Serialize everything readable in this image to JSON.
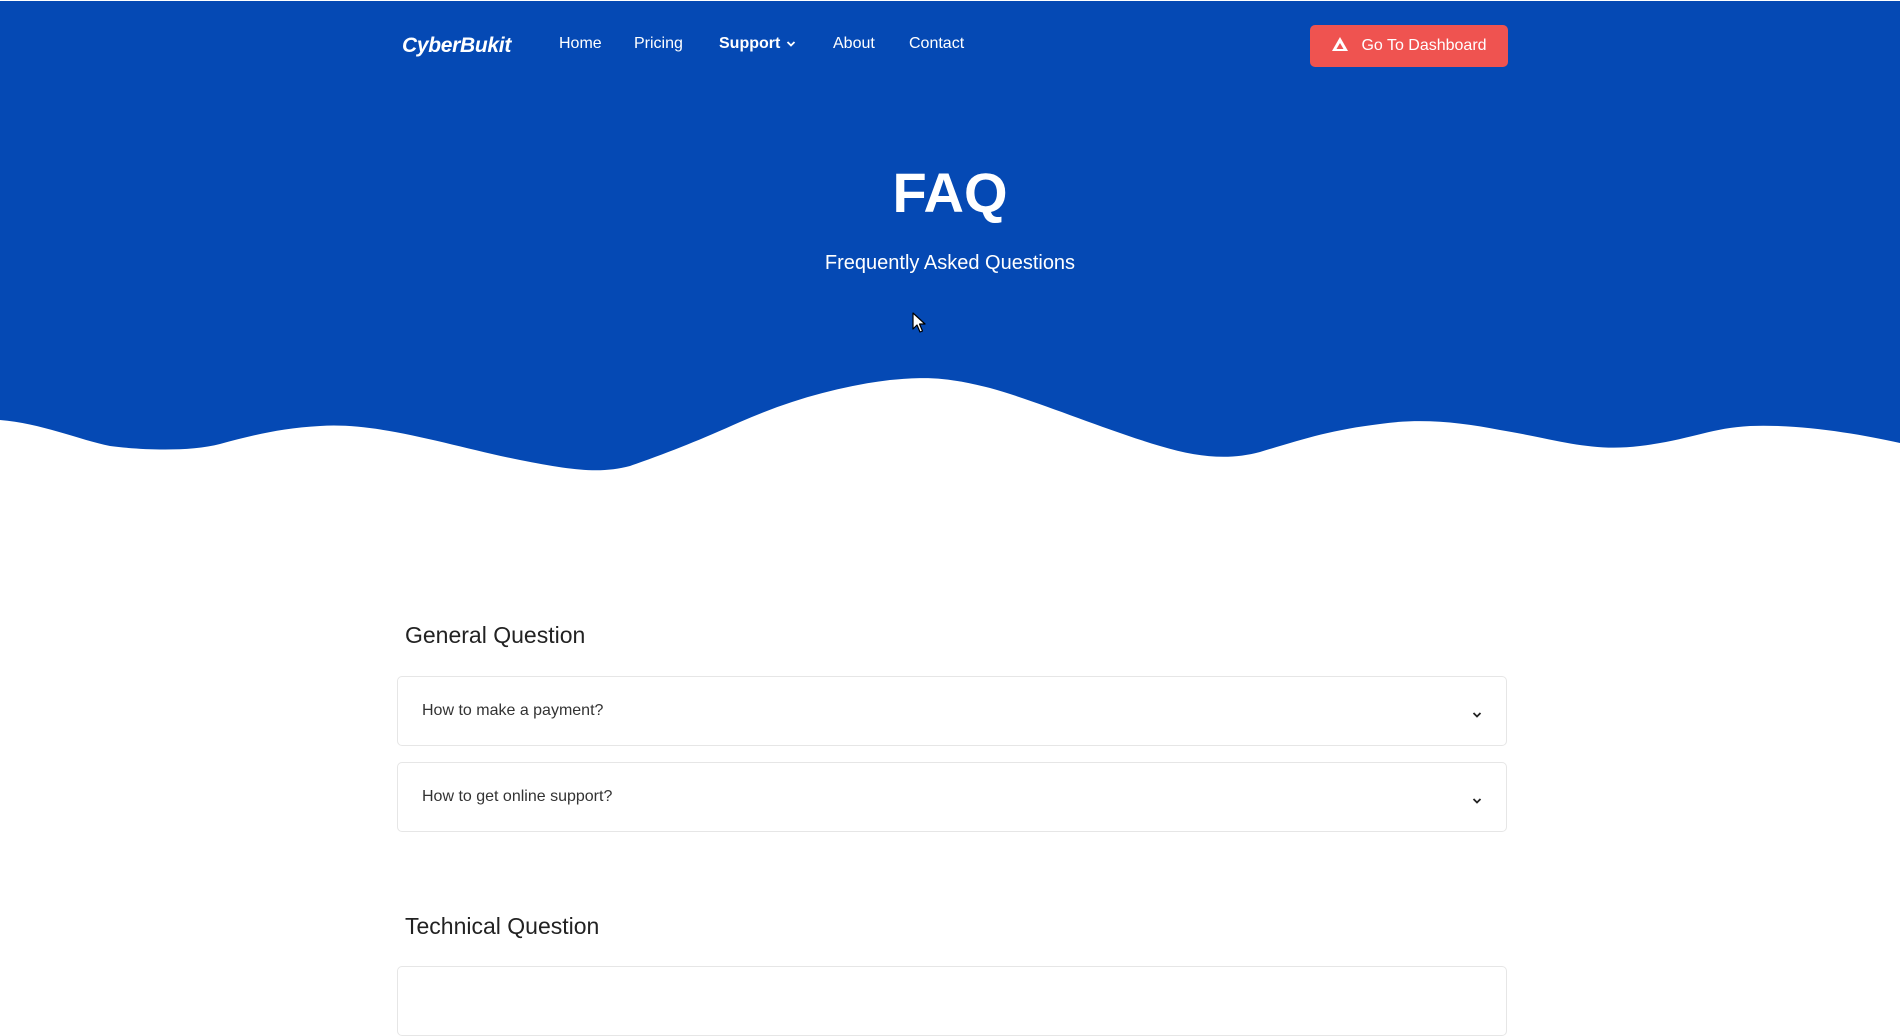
{
  "colors": {
    "hero_bg": "#0549b4",
    "accent_button": "#ef5350",
    "text_dark": "#222222"
  },
  "nav": {
    "brand": "CyberBukit",
    "items": [
      {
        "label": "Home"
      },
      {
        "label": "Pricing"
      },
      {
        "label": "Support",
        "icon": "chevron-down-icon",
        "active": true
      },
      {
        "label": "About"
      },
      {
        "label": "Contact"
      }
    ],
    "dashboard_button": {
      "label": "Go To Dashboard",
      "icon": "triangle-logo-icon"
    }
  },
  "hero": {
    "title": "FAQ",
    "subtitle": "Frequently Asked Questions"
  },
  "sections": [
    {
      "title": "General Question",
      "questions": [
        {
          "text": "How to make a payment?",
          "icon": "chevron-down-icon"
        },
        {
          "text": "How to get online support?",
          "icon": "chevron-down-icon"
        }
      ]
    },
    {
      "title": "Technical Question",
      "questions": []
    }
  ]
}
